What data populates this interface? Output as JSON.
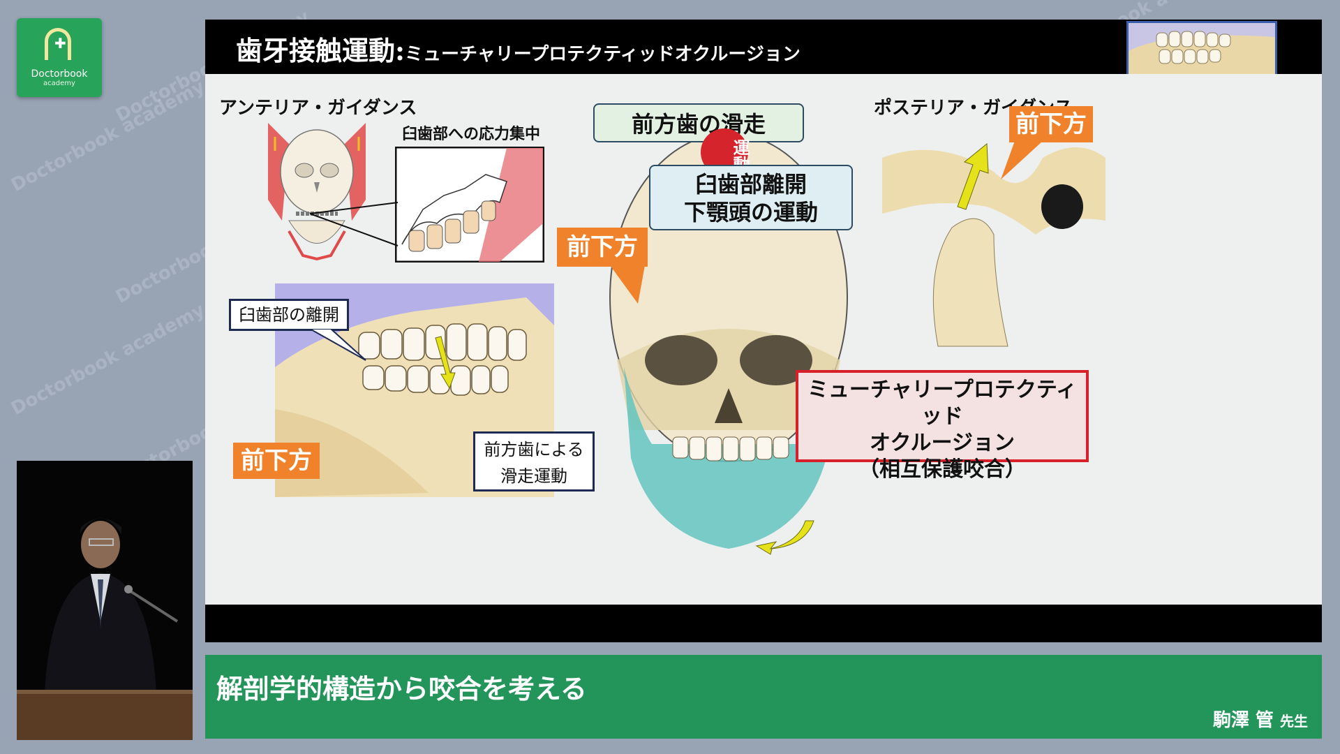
{
  "watermark": {
    "text": "Doctorbook academy"
  },
  "logo": {
    "line1": "Doctorbook",
    "line2": "academy",
    "icon": "arch-cross-icon",
    "color": "#27a35a"
  },
  "slide": {
    "title_main": "歯牙接触運動:",
    "title_sub": "ミューチャリープロテクティッドオクルージョン",
    "anterior_label": "アンテリア・ガイダンス",
    "stress_label": "臼歯部への応力集中",
    "molar_separation_label": "臼歯部の離開",
    "sliding_label_line1": "前方歯による",
    "sliding_label_line2": "滑走運動",
    "forward_down_1": "前下方",
    "forward_down_2": "前下方",
    "forward_down_3": "前下方",
    "center_top": "前方歯の滑走",
    "motion_badge": "運動",
    "center_box_line1": "臼歯部離開",
    "center_box_line2": "下顎頭の運動",
    "posterior_label": "ポステリア・ガイダンス",
    "mpo_line1": "ミューチャリープロテクティッド",
    "mpo_line2": "オクルージョン",
    "mpo_line3": "（相互保護咬合）"
  },
  "caption": {
    "title": "解剖学的構造から咬合を考える",
    "presenter": "駒澤 管",
    "presenter_suffix": "先生"
  },
  "colors": {
    "accent_green": "#23955a",
    "orange": "#f0822b",
    "red_border": "#d8202a",
    "navy": "#1d2a52"
  }
}
